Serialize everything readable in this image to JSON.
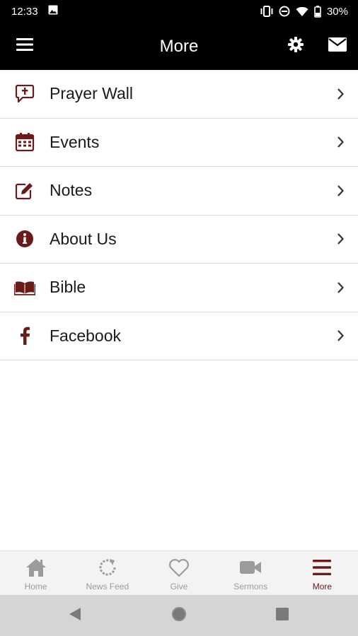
{
  "status_bar": {
    "time": "12:33",
    "battery": "30%"
  },
  "app_bar": {
    "title": "More"
  },
  "colors": {
    "accent": "#6b1a1a",
    "inactive": "#9b9b9b",
    "bar": "#000000"
  },
  "menu": {
    "items": [
      {
        "label": "Prayer Wall",
        "icon": "prayer-bubble-icon"
      },
      {
        "label": "Events",
        "icon": "calendar-icon"
      },
      {
        "label": "Notes",
        "icon": "edit-icon"
      },
      {
        "label": "About Us",
        "icon": "info-icon"
      },
      {
        "label": "Bible",
        "icon": "book-icon"
      },
      {
        "label": "Facebook",
        "icon": "facebook-icon"
      }
    ]
  },
  "tabs": [
    {
      "label": "Home",
      "icon": "home-icon",
      "active": false
    },
    {
      "label": "News Feed",
      "icon": "refresh-icon",
      "active": false
    },
    {
      "label": "Give",
      "icon": "heart-icon",
      "active": false
    },
    {
      "label": "Sermons",
      "icon": "video-camera-icon",
      "active": false
    },
    {
      "label": "More",
      "icon": "bars-icon",
      "active": true
    }
  ]
}
